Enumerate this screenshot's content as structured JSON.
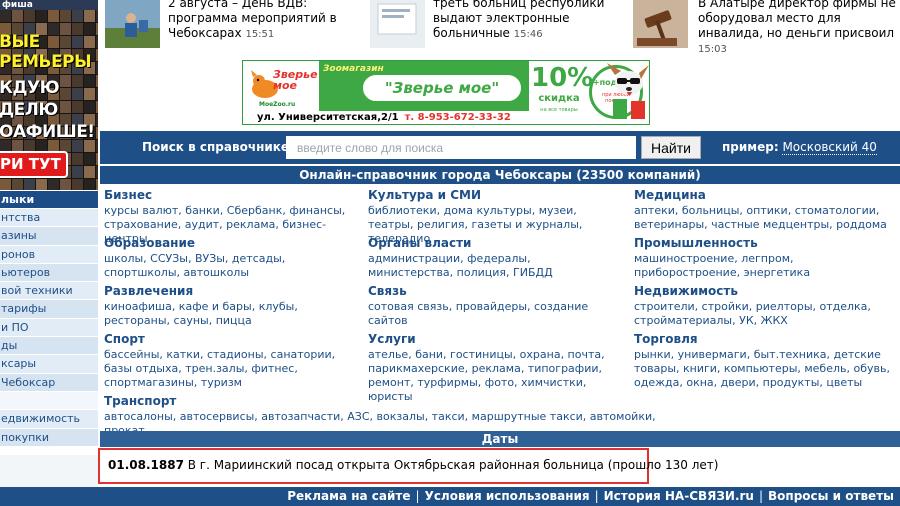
{
  "sidebar": {
    "promo_top": "фиша",
    "promo_lines": [
      "ВЫЕ",
      "РЕМЬЕРЫ",
      "КДУЮ",
      "ДЕЛЮ",
      "ОАФИШЕ!"
    ],
    "promo_button": "РИ ТУТ",
    "menu_title": "лыки",
    "menu_items": [
      "нтства",
      "азины",
      "ронов",
      "ьютеров",
      "вой техники",
      "тарифы",
      "и ПО",
      "ды",
      "ксары",
      "Чебоксар",
      "",
      "едвижимость",
      "покупки"
    ]
  },
  "news": [
    {
      "text": "2 августа – День ВДВ: программа мероприятий в Чебоксарах",
      "time": "15:51"
    },
    {
      "text": "треть больниц республики выдают электронные больничные",
      "time": "15:46"
    },
    {
      "text": "В Алатыре директор фирмы не оборудовал место для инвалида, но деньги присвоил",
      "time": "15:03"
    }
  ],
  "banner": {
    "logo": "Зверье мое",
    "site": "MoeZoo.ru",
    "label": "Зоомагазин",
    "name": "\"Зверье мое\"",
    "discount": "10%",
    "discount_label": "скидка",
    "discount_small": "на все товары",
    "gift": "+подарок",
    "gift_small": "при любой покупке",
    "address": "ул. Университетская,2/1",
    "phone": "т. 8-953-672-33-32",
    "colors": {
      "green": "#3ea844",
      "red": "#e4332b"
    }
  },
  "search": {
    "label": "Поиск в справочнике",
    "placeholder": "введите слово для поиска",
    "button": "Найти",
    "example_label": "пример:",
    "example_value": "Московский 40"
  },
  "directory": {
    "title": "Онлайн-справочник города Чебоксары (23500 компаний)",
    "categories": [
      {
        "title": "Бизнес",
        "links": "курсы валют, банки, Сбербанк, финансы, страхование, аудит, реклама, бизнес-центры"
      },
      {
        "title": "Образование",
        "links": "школы, ССУЗы, ВУЗы, детсады, спортшколы, автошколы"
      },
      {
        "title": "Развлечения",
        "links": "киноафиша, кафе и бары, клубы, рестораны, сауны, пицца"
      },
      {
        "title": "Спорт",
        "links": "бассейны, катки, стадионы, санатории, базы отдыха, трен.залы, фитнес, спортмагазины, туризм"
      },
      {
        "title": "Транспорт",
        "links": "автосалоны, автосервисы, автозапчасти, АЗС, вокзалы, такси, маршрутные такси, автомойки, прокат"
      },
      {
        "title": "Культура и СМИ",
        "links": "библиотеки, дома культуры, музеи, театры, религия, газеты и журналы, телерадио"
      },
      {
        "title": "Органы власти",
        "links": "администрации, федералы, министерства, полиция, ГИБДД"
      },
      {
        "title": "Связь",
        "links": "сотовая связь, провайдеры, создание сайтов"
      },
      {
        "title": "Услуги",
        "links": "ателье, бани, гостиницы, охрана, почта, парикмахерские, реклама, типографии, ремонт, турфирмы, фото, химчистки, юристы"
      },
      {
        "title": "Медицина",
        "links": "аптеки, больницы, оптики, стоматологии, ветеринары, частные медцентры, роддома"
      },
      {
        "title": "Промышленность",
        "links": "машиностроение, легпром, приборостроение, энергетика"
      },
      {
        "title": "Недвижимость",
        "links": "строители, стройки, риелторы, отделка, стройматериалы, УК, ЖКХ"
      },
      {
        "title": "Торговля",
        "links": "рынки, универмаги, быт.техника, детские товары, книги, компьютеры, мебель, обувь, одежда, окна, двери, продукты, цветы"
      }
    ]
  },
  "dates": {
    "title": "Даты",
    "date": "01.08.1887",
    "text": "В г. Мариинский посад открыта Октябрьская районная больница (прошло 130 лет)"
  },
  "footer": {
    "links": [
      "Реклама на сайте",
      "Условия использования",
      "История НА-СВЯЗИ.ru",
      "Вопросы и ответы"
    ]
  }
}
